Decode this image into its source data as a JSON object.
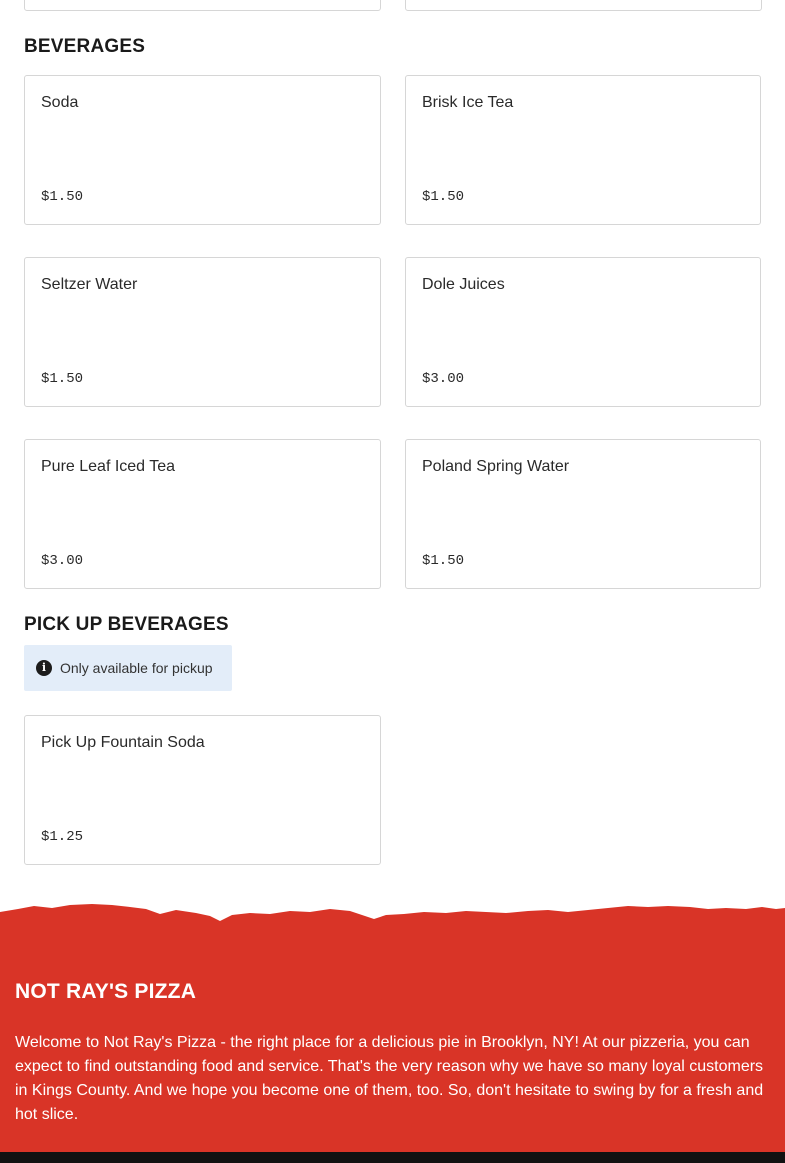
{
  "sections": {
    "beverages": {
      "title": "BEVERAGES",
      "items": [
        {
          "name": "Soda",
          "price": "$1.50"
        },
        {
          "name": "Brisk Ice Tea",
          "price": "$1.50"
        },
        {
          "name": "Seltzer Water",
          "price": "$1.50"
        },
        {
          "name": "Dole Juices",
          "price": "$3.00"
        },
        {
          "name": "Pure Leaf Iced Tea",
          "price": "$3.00"
        },
        {
          "name": "Poland Spring Water",
          "price": "$1.50"
        }
      ]
    },
    "pickup_beverages": {
      "title": "PICK UP BEVERAGES",
      "notice": "Only available for pickup",
      "items": [
        {
          "name": "Pick Up Fountain Soda",
          "price": "$1.25"
        }
      ]
    }
  },
  "footer": {
    "brand": "NOT RAY'S PIZZA",
    "about": "Welcome to Not Ray's Pizza - the right place for a delicious pie in Brooklyn, NY! At our pizzeria, you can expect to find outstanding food and service. That's the very reason why we have so many loyal customers in Kings County. And we hope you become one of them, too. So, don't hesitate to swing by for a fresh and hot slice."
  },
  "colors": {
    "footer_bg": "#d93427",
    "notice_bg": "#e3edf9",
    "card_border": "#d6d6d6"
  }
}
